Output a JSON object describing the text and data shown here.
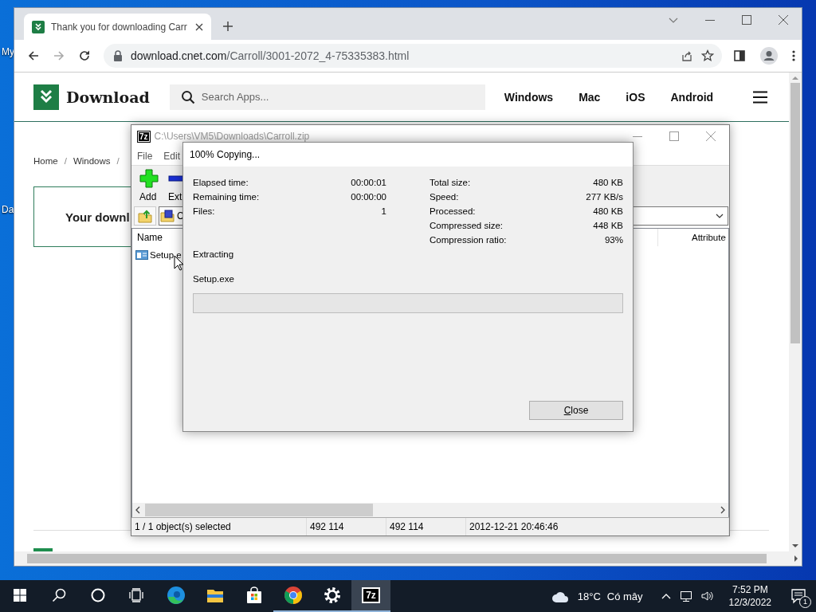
{
  "desktop": {
    "icons": [
      {
        "label": "My"
      },
      {
        "label": "Da"
      }
    ]
  },
  "browser": {
    "tab": {
      "title": "Thank you for downloading Carr",
      "selected": true
    },
    "address": {
      "host": "download.cnet.com",
      "path": "/Carroll/3001-2072_4-75335383.html"
    },
    "site": {
      "logo": "Download",
      "search": {
        "placeholder": "Search Apps..."
      },
      "nav": [
        "Windows",
        "Mac",
        "iOS",
        "Android"
      ],
      "breadcrumb": [
        {
          "kind": "link",
          "label": "Home"
        },
        {
          "kind": "separator",
          "label": "/"
        },
        {
          "kind": "link",
          "label": "Windows"
        },
        {
          "kind": "separator",
          "label": "/"
        }
      ],
      "banner": "Your downl"
    }
  },
  "archive_window": {
    "icon_label": "7z",
    "title": "C:\\Users\\VM5\\Downloads\\Carroll.zip",
    "menu": [
      "File",
      "Edit"
    ],
    "toolbar": [
      {
        "kind": "add",
        "label": "Add"
      },
      {
        "kind": "extract",
        "label": "Ext"
      }
    ],
    "path": "C",
    "columns": [
      "Name",
      "Attribute"
    ],
    "rows": [
      {
        "name": "Setup.e"
      }
    ],
    "status_bar": [
      "1 / 1 object(s) selected",
      "492 114",
      "492 114",
      "2012-12-21 20:46:46"
    ]
  },
  "dialog": {
    "title": "100% Copying...",
    "stats_left": [
      {
        "label": "Elapsed time:",
        "value": "00:00:01"
      },
      {
        "label": "Remaining time:",
        "value": "00:00:00"
      },
      {
        "label": "Files:",
        "value": "1"
      }
    ],
    "stats_right": [
      {
        "label": "Total size:",
        "value": "480 KB"
      },
      {
        "label": "Speed:",
        "value": "277 KB/s"
      },
      {
        "label": "Processed:",
        "value": "480 KB"
      },
      {
        "label": "Compressed size:",
        "value": "448 KB"
      },
      {
        "label": "Compression ratio:",
        "value": "93%"
      }
    ],
    "operation": "Extracting",
    "file": "Setup.exe",
    "progress": {
      "level": 0
    },
    "buttons": [
      "Close"
    ]
  },
  "taskbar": {
    "apps": [
      {
        "kind": "start",
        "running": false,
        "selected": false
      },
      {
        "kind": "search",
        "running": false,
        "selected": false
      },
      {
        "kind": "cortana",
        "running": false,
        "selected": false
      },
      {
        "kind": "taskview",
        "running": false,
        "selected": false
      },
      {
        "kind": "edge",
        "running": false,
        "selected": false
      },
      {
        "kind": "explorer",
        "running": false,
        "selected": false
      },
      {
        "kind": "store",
        "running": false,
        "selected": false
      },
      {
        "kind": "chrome",
        "running": true,
        "selected": false
      },
      {
        "kind": "settings",
        "running": true,
        "selected": false
      },
      {
        "kind": "sevenzip",
        "label": "7z",
        "running": true,
        "selected": true
      }
    ],
    "weather": {
      "temperature": "18°C",
      "condition": "Có mây"
    },
    "clock": {
      "time": "7:52 PM",
      "date": "12/3/2022"
    },
    "notifications": {
      "count": "1"
    }
  }
}
